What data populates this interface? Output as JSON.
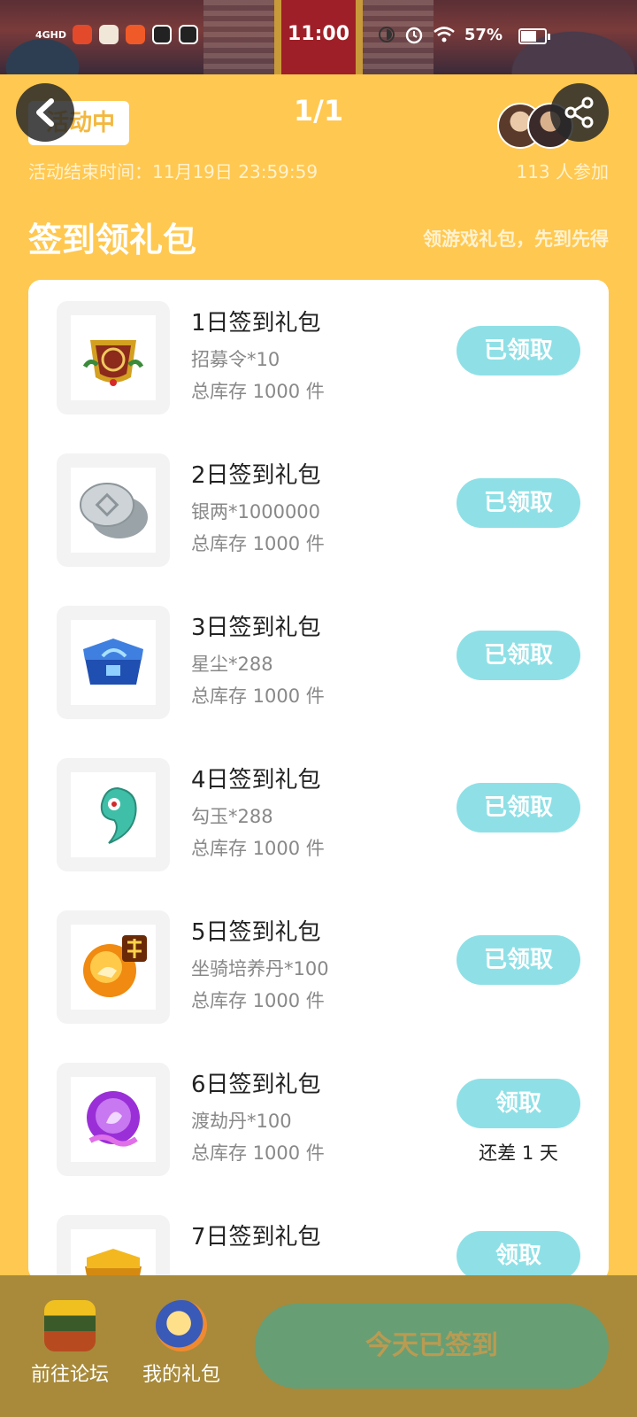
{
  "status_bar": {
    "time": "11:00",
    "battery": "57%",
    "network": "4GHD"
  },
  "header": {
    "status_badge": "活动中",
    "pager": "1/1",
    "end_time": "活动结束时间：11月19日 23:59:59",
    "participants": "113 人参加"
  },
  "section": {
    "title": "签到领礼包",
    "subtitle": "领游戏礼包，先到先得"
  },
  "items": [
    {
      "name": "1日签到礼包",
      "desc": "招募令*10",
      "stock": "总库存 1000 件",
      "button": "已领取",
      "note": ""
    },
    {
      "name": "2日签到礼包",
      "desc": "银两*1000000",
      "stock": "总库存 1000 件",
      "button": "已领取",
      "note": ""
    },
    {
      "name": "3日签到礼包",
      "desc": "星尘*288",
      "stock": "总库存 1000 件",
      "button": "已领取",
      "note": ""
    },
    {
      "name": "4日签到礼包",
      "desc": "勾玉*288",
      "stock": "总库存 1000 件",
      "button": "已领取",
      "note": ""
    },
    {
      "name": "5日签到礼包",
      "desc": "坐骑培养丹*100",
      "stock": "总库存 1000 件",
      "button": "已领取",
      "note": ""
    },
    {
      "name": "6日签到礼包",
      "desc": "渡劫丹*100",
      "stock": "总库存 1000 件",
      "button": "领取",
      "note": "还差 1 天"
    },
    {
      "name": "7日签到礼包",
      "desc": "",
      "stock": "",
      "button": "领取",
      "note": ""
    }
  ],
  "bottom": {
    "forum_label": "前往论坛",
    "gifts_label": "我的礼包",
    "signin_label": "今天已签到"
  },
  "colors": {
    "background": "#ffc850",
    "claim_button": "#8ee0e6",
    "signin_button": "#689e74",
    "bottom_bar": "#a88a3a"
  }
}
